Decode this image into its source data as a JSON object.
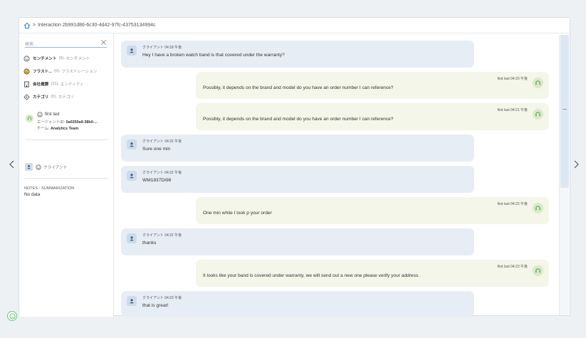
{
  "breadcrumb": {
    "separator": ">",
    "title": "Interaction 2b991d86-6c30-4d42-97fc-43753134994c"
  },
  "search": {
    "placeholder": "検索..."
  },
  "filters": [
    {
      "label": "センチメント",
      "count": "(5)",
      "sub": "- センチメント"
    },
    {
      "label": "フラスト...",
      "count": "(0)",
      "sub": "- フラストレーション"
    },
    {
      "label": "会社概要",
      "count": "(21)",
      "sub": "- エンティティ"
    },
    {
      "label": "カテゴリ",
      "count": "(0)",
      "sub": "- カテゴリ"
    }
  ],
  "agent": {
    "name": "first last",
    "id_label": "エージェントID:",
    "id_value": "0a0250a9-38b0-...",
    "team_label": "チーム:",
    "team_value": "Analytics Team"
  },
  "client": {
    "label": "クライアント"
  },
  "notes": {
    "title": "NOTES - SUMMARIZATION",
    "value": "No data"
  },
  "messages": [
    {
      "role": "client",
      "meta": "クライアント 04:18 午後",
      "text": "Hey I have a broken watch band is that covered under the warranty?"
    },
    {
      "role": "agent",
      "meta": "first last 04:20 午後",
      "text": "Possibly, it depends on the brand and model do you have an order number I can reference?"
    },
    {
      "role": "agent",
      "meta": "first last 04:21 午後",
      "text": "Possibly, it depends on the brand and model do you have an order number I can reference?"
    },
    {
      "role": "client",
      "meta": "クライアント 04:22 午後",
      "text": "Sure one min"
    },
    {
      "role": "client",
      "meta": "クライアント 04:22 午後",
      "text": "WM1837DI98"
    },
    {
      "role": "agent",
      "meta": "first last 04:22 午後",
      "text": "One min while I look p your order"
    },
    {
      "role": "client",
      "meta": "クライアント 04:22 午後",
      "text": "thanks"
    },
    {
      "role": "agent",
      "meta": "first last 04:23 午後",
      "text": "It looks like your band is covered under warranty, we will send out a new one please verify your address."
    },
    {
      "role": "client",
      "meta": "クライアント 04:23 午後",
      "text": "that is great!"
    }
  ],
  "colors": {
    "client_bubble": "#e7edf4",
    "agent_bubble": "#f3f6e8",
    "accent_green": "#4caf50"
  }
}
